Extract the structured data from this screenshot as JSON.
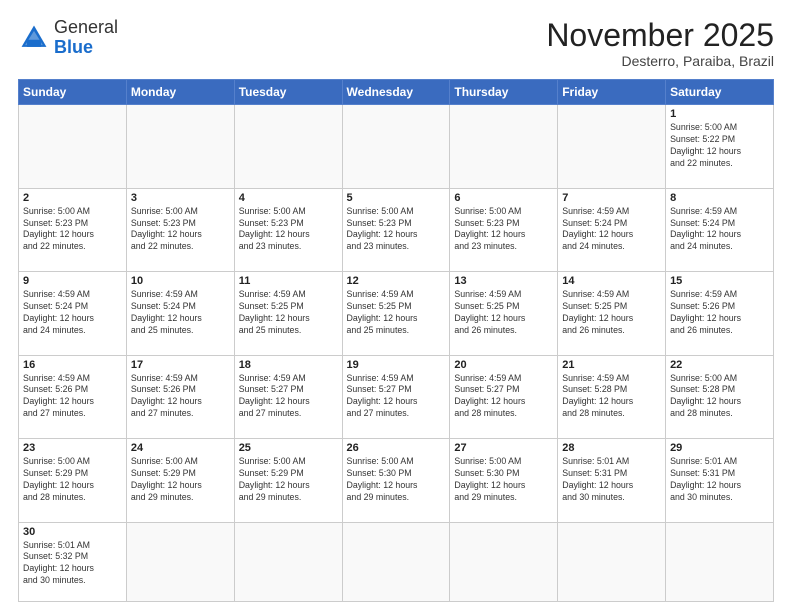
{
  "logo": {
    "text_general": "General",
    "text_blue": "Blue"
  },
  "header": {
    "month": "November 2025",
    "location": "Desterro, Paraiba, Brazil"
  },
  "days_of_week": [
    "Sunday",
    "Monday",
    "Tuesday",
    "Wednesday",
    "Thursday",
    "Friday",
    "Saturday"
  ],
  "weeks": [
    [
      {
        "day": "",
        "info": ""
      },
      {
        "day": "",
        "info": ""
      },
      {
        "day": "",
        "info": ""
      },
      {
        "day": "",
        "info": ""
      },
      {
        "day": "",
        "info": ""
      },
      {
        "day": "",
        "info": ""
      },
      {
        "day": "1",
        "info": "Sunrise: 5:00 AM\nSunset: 5:22 PM\nDaylight: 12 hours\nand 22 minutes."
      }
    ],
    [
      {
        "day": "2",
        "info": "Sunrise: 5:00 AM\nSunset: 5:23 PM\nDaylight: 12 hours\nand 22 minutes."
      },
      {
        "day": "3",
        "info": "Sunrise: 5:00 AM\nSunset: 5:23 PM\nDaylight: 12 hours\nand 22 minutes."
      },
      {
        "day": "4",
        "info": "Sunrise: 5:00 AM\nSunset: 5:23 PM\nDaylight: 12 hours\nand 23 minutes."
      },
      {
        "day": "5",
        "info": "Sunrise: 5:00 AM\nSunset: 5:23 PM\nDaylight: 12 hours\nand 23 minutes."
      },
      {
        "day": "6",
        "info": "Sunrise: 5:00 AM\nSunset: 5:23 PM\nDaylight: 12 hours\nand 23 minutes."
      },
      {
        "day": "7",
        "info": "Sunrise: 4:59 AM\nSunset: 5:24 PM\nDaylight: 12 hours\nand 24 minutes."
      },
      {
        "day": "8",
        "info": "Sunrise: 4:59 AM\nSunset: 5:24 PM\nDaylight: 12 hours\nand 24 minutes."
      }
    ],
    [
      {
        "day": "9",
        "info": "Sunrise: 4:59 AM\nSunset: 5:24 PM\nDaylight: 12 hours\nand 24 minutes."
      },
      {
        "day": "10",
        "info": "Sunrise: 4:59 AM\nSunset: 5:24 PM\nDaylight: 12 hours\nand 25 minutes."
      },
      {
        "day": "11",
        "info": "Sunrise: 4:59 AM\nSunset: 5:25 PM\nDaylight: 12 hours\nand 25 minutes."
      },
      {
        "day": "12",
        "info": "Sunrise: 4:59 AM\nSunset: 5:25 PM\nDaylight: 12 hours\nand 25 minutes."
      },
      {
        "day": "13",
        "info": "Sunrise: 4:59 AM\nSunset: 5:25 PM\nDaylight: 12 hours\nand 26 minutes."
      },
      {
        "day": "14",
        "info": "Sunrise: 4:59 AM\nSunset: 5:25 PM\nDaylight: 12 hours\nand 26 minutes."
      },
      {
        "day": "15",
        "info": "Sunrise: 4:59 AM\nSunset: 5:26 PM\nDaylight: 12 hours\nand 26 minutes."
      }
    ],
    [
      {
        "day": "16",
        "info": "Sunrise: 4:59 AM\nSunset: 5:26 PM\nDaylight: 12 hours\nand 27 minutes."
      },
      {
        "day": "17",
        "info": "Sunrise: 4:59 AM\nSunset: 5:26 PM\nDaylight: 12 hours\nand 27 minutes."
      },
      {
        "day": "18",
        "info": "Sunrise: 4:59 AM\nSunset: 5:27 PM\nDaylight: 12 hours\nand 27 minutes."
      },
      {
        "day": "19",
        "info": "Sunrise: 4:59 AM\nSunset: 5:27 PM\nDaylight: 12 hours\nand 27 minutes."
      },
      {
        "day": "20",
        "info": "Sunrise: 4:59 AM\nSunset: 5:27 PM\nDaylight: 12 hours\nand 28 minutes."
      },
      {
        "day": "21",
        "info": "Sunrise: 4:59 AM\nSunset: 5:28 PM\nDaylight: 12 hours\nand 28 minutes."
      },
      {
        "day": "22",
        "info": "Sunrise: 5:00 AM\nSunset: 5:28 PM\nDaylight: 12 hours\nand 28 minutes."
      }
    ],
    [
      {
        "day": "23",
        "info": "Sunrise: 5:00 AM\nSunset: 5:29 PM\nDaylight: 12 hours\nand 28 minutes."
      },
      {
        "day": "24",
        "info": "Sunrise: 5:00 AM\nSunset: 5:29 PM\nDaylight: 12 hours\nand 29 minutes."
      },
      {
        "day": "25",
        "info": "Sunrise: 5:00 AM\nSunset: 5:29 PM\nDaylight: 12 hours\nand 29 minutes."
      },
      {
        "day": "26",
        "info": "Sunrise: 5:00 AM\nSunset: 5:30 PM\nDaylight: 12 hours\nand 29 minutes."
      },
      {
        "day": "27",
        "info": "Sunrise: 5:00 AM\nSunset: 5:30 PM\nDaylight: 12 hours\nand 29 minutes."
      },
      {
        "day": "28",
        "info": "Sunrise: 5:01 AM\nSunset: 5:31 PM\nDaylight: 12 hours\nand 30 minutes."
      },
      {
        "day": "29",
        "info": "Sunrise: 5:01 AM\nSunset: 5:31 PM\nDaylight: 12 hours\nand 30 minutes."
      }
    ],
    [
      {
        "day": "30",
        "info": "Sunrise: 5:01 AM\nSunset: 5:32 PM\nDaylight: 12 hours\nand 30 minutes."
      },
      {
        "day": "",
        "info": ""
      },
      {
        "day": "",
        "info": ""
      },
      {
        "day": "",
        "info": ""
      },
      {
        "day": "",
        "info": ""
      },
      {
        "day": "",
        "info": ""
      },
      {
        "day": "",
        "info": ""
      }
    ]
  ]
}
